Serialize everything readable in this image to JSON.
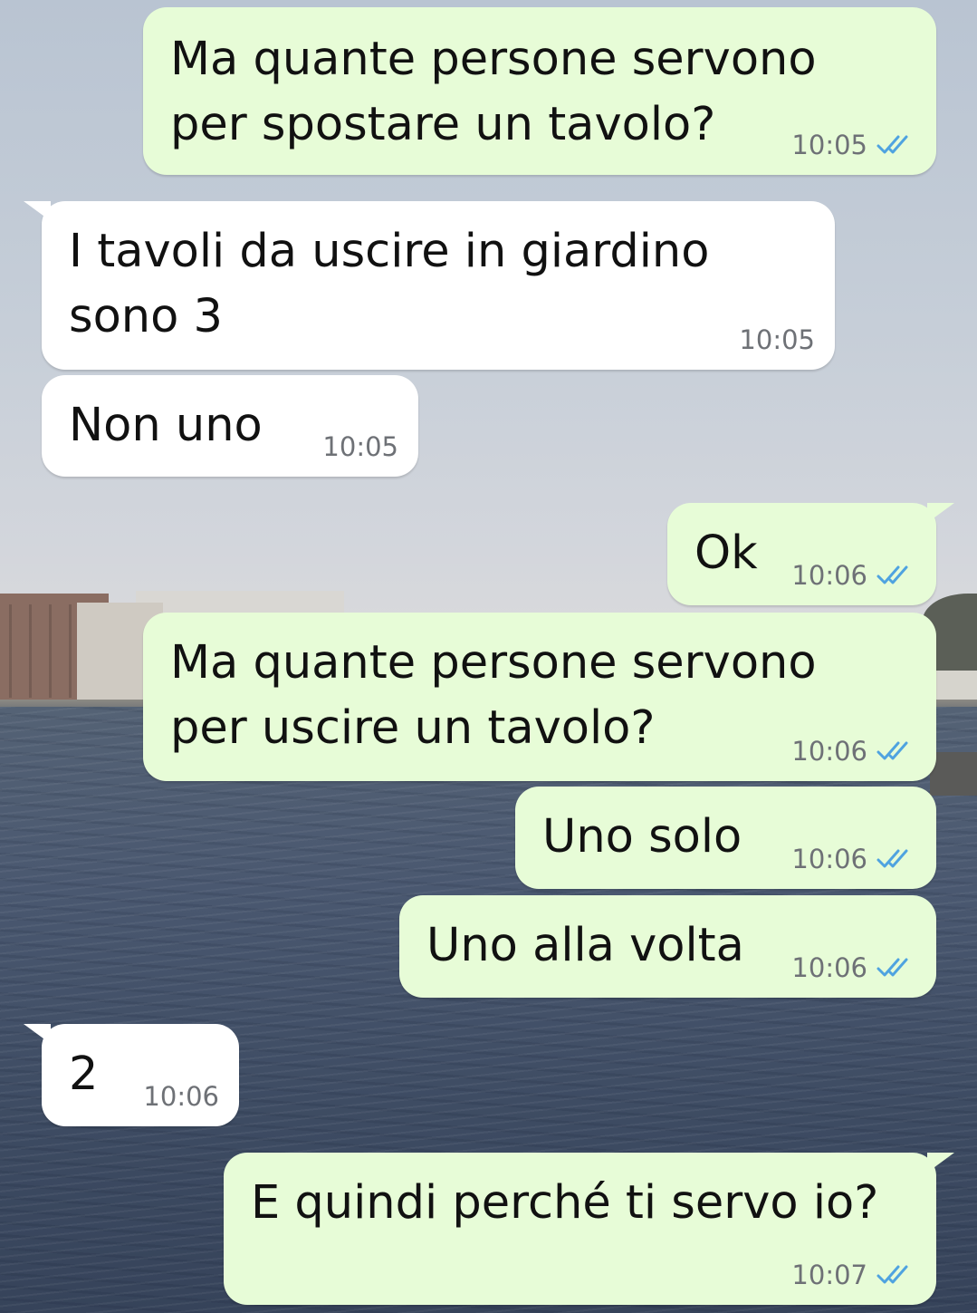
{
  "messages": [
    {
      "text": "Ma quante persone servono\nper spostare un tavolo?",
      "time": "10:05",
      "direction": "sent",
      "read": true
    },
    {
      "text": "I tavoli da uscire in giardino\nsono 3",
      "time": "10:05",
      "direction": "received"
    },
    {
      "text": "Non uno",
      "time": "10:05",
      "direction": "received"
    },
    {
      "text": "Ok",
      "time": "10:06",
      "direction": "sent",
      "read": true
    },
    {
      "text": "Ma quante persone servono\nper uscire un tavolo?",
      "time": "10:06",
      "direction": "sent",
      "read": true
    },
    {
      "text": "Uno solo",
      "time": "10:06",
      "direction": "sent",
      "read": true
    },
    {
      "text": "Uno alla volta",
      "time": "10:06",
      "direction": "sent",
      "read": true
    },
    {
      "text": "2",
      "time": "10:06",
      "direction": "received"
    },
    {
      "text": "E quindi perché ti servo io?",
      "time": "10:07",
      "direction": "sent",
      "read": true
    }
  ],
  "colors": {
    "sent_bubble": "#e7fcd7",
    "received_bubble": "#ffffff",
    "read_ticks": "#4fa3e0",
    "timestamp": "#6e7176"
  },
  "icons": {
    "read_receipt": "double-check-icon"
  }
}
